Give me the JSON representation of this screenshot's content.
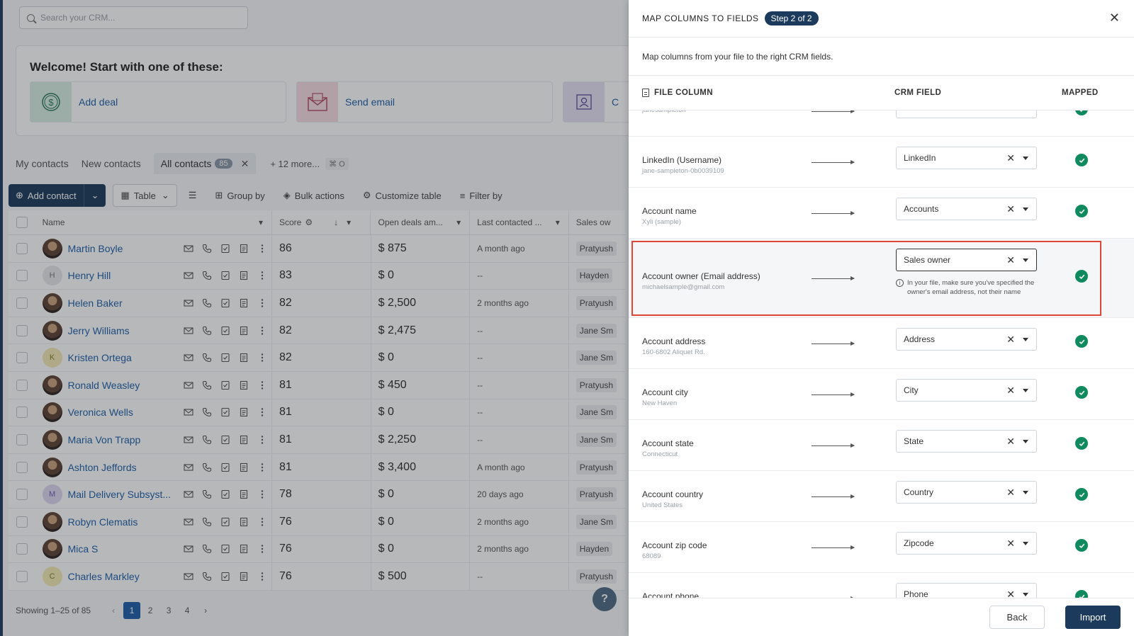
{
  "search": {
    "placeholder": "Search your CRM..."
  },
  "welcome": {
    "title": "Welcome! Start with one of these:",
    "cards": [
      {
        "label": "Add deal",
        "icon": "dollar-coin-icon",
        "color": "#d8efe4"
      },
      {
        "label": "Send email",
        "icon": "envelope-icon",
        "color": "#f6dde2"
      },
      {
        "label": "C",
        "icon": "frame-user-icon",
        "color": "#e6e1f4"
      }
    ]
  },
  "tabs": {
    "my_contacts": "My contacts",
    "new_contacts": "New contacts",
    "all_contacts": "All contacts",
    "all_count": "85",
    "more": "+ 12 more...",
    "shortcut": "⌘ O"
  },
  "toolbar": {
    "add_contact": "Add contact",
    "table": "Table",
    "group_by": "Group by",
    "bulk_actions": "Bulk actions",
    "customize_table": "Customize table",
    "filter_by": "Filter by"
  },
  "table": {
    "headers": {
      "name": "Name",
      "score": "Score",
      "deals": "Open deals am...",
      "last": "Last contacted ...",
      "owner": "Sales ow"
    },
    "rows": [
      {
        "name": "Martin Boyle",
        "avatar": "photo",
        "initial": "",
        "score": "86",
        "deal": "$ 875",
        "last": "A month ago",
        "owner": "Pratyush"
      },
      {
        "name": "Henry Hill",
        "avatar": "h",
        "initial": "H",
        "score": "83",
        "deal": "$ 0",
        "last": "--",
        "owner": "Hayden"
      },
      {
        "name": "Helen Baker",
        "avatar": "photo",
        "initial": "",
        "score": "82",
        "deal": "$ 2,500",
        "last": "2 months ago",
        "owner": "Pratyush"
      },
      {
        "name": "Jerry Williams",
        "avatar": "photo",
        "initial": "",
        "score": "82",
        "deal": "$ 2,475",
        "last": "--",
        "owner": "Jane Sm"
      },
      {
        "name": "Kristen Ortega",
        "avatar": "k",
        "initial": "K",
        "score": "82",
        "deal": "$ 0",
        "last": "--",
        "owner": "Jane Sm"
      },
      {
        "name": "Ronald Weasley",
        "avatar": "photo",
        "initial": "",
        "score": "81",
        "deal": "$ 450",
        "last": "--",
        "owner": "Pratyush"
      },
      {
        "name": "Veronica Wells",
        "avatar": "photo",
        "initial": "",
        "score": "81",
        "deal": "$ 0",
        "last": "--",
        "owner": "Jane Sm"
      },
      {
        "name": "Maria Von Trapp",
        "avatar": "photo",
        "initial": "",
        "score": "81",
        "deal": "$ 2,250",
        "last": "--",
        "owner": "Jane Sm"
      },
      {
        "name": "Ashton Jeffords",
        "avatar": "photo",
        "initial": "",
        "score": "81",
        "deal": "$ 3,400",
        "last": "A month ago",
        "owner": "Pratyush"
      },
      {
        "name": "Mail Delivery Subsyst...",
        "avatar": "m",
        "initial": "M",
        "score": "78",
        "deal": "$ 0",
        "last": "20 days ago",
        "owner": "Pratyush"
      },
      {
        "name": "Robyn Clematis",
        "avatar": "photo",
        "initial": "",
        "score": "76",
        "deal": "$ 0",
        "last": "2 months ago",
        "owner": "Jane Sm"
      },
      {
        "name": "Mica S",
        "avatar": "photo",
        "initial": "",
        "score": "76",
        "deal": "$ 0",
        "last": "2 months ago",
        "owner": "Hayden"
      },
      {
        "name": "Charles Markley",
        "avatar": "c",
        "initial": "C",
        "score": "76",
        "deal": "$ 500",
        "last": "--",
        "owner": "Pratyush"
      }
    ]
  },
  "pager": {
    "showing": "Showing 1–25 of 85",
    "prev": "‹",
    "next": "›",
    "pages": [
      "1",
      "2",
      "3",
      "4"
    ],
    "current": "1"
  },
  "help": "?",
  "panel": {
    "title": "MAP COLUMNS TO FIELDS",
    "step": "Step 2 of 2",
    "close": "✕",
    "description": "Map columns from your file to the right CRM fields.",
    "headers": {
      "file": "FILE COLUMN",
      "crm": "CRM FIELD",
      "mapped": "MAPPED"
    },
    "rows": [
      {
        "name": "",
        "sample": "janesampleton",
        "field": ""
      },
      {
        "name": "LinkedIn (Username)",
        "sample": "jane-sampleton-0b0039109",
        "field": "LinkedIn"
      },
      {
        "name": "Account name",
        "sample": "Xyli (sample)",
        "field": "Accounts"
      },
      {
        "name": "Account owner (Email address)",
        "sample": "michaelsample@gmail.com",
        "field": "Sales owner",
        "highlight": true,
        "hint": "In your file, make sure you've specified the owner's email address, not their name"
      },
      {
        "name": "Account address",
        "sample": "160-6802 Aliquet Rd.",
        "field": "Address"
      },
      {
        "name": "Account city",
        "sample": "New Haven",
        "field": "City"
      },
      {
        "name": "Account state",
        "sample": "Connecticut",
        "field": "State"
      },
      {
        "name": "Account country",
        "sample": "United States",
        "field": "Country"
      },
      {
        "name": "Account zip code",
        "sample": "68089",
        "field": "Zipcode"
      },
      {
        "name": "Account phone",
        "sample": "",
        "field": "Phone"
      }
    ],
    "back": "Back",
    "import": "Import"
  },
  "colors": {
    "primary": "#1b3a5c",
    "link": "#1d5fa8",
    "success": "#0f8a5f",
    "highlight": "#e0453a"
  }
}
